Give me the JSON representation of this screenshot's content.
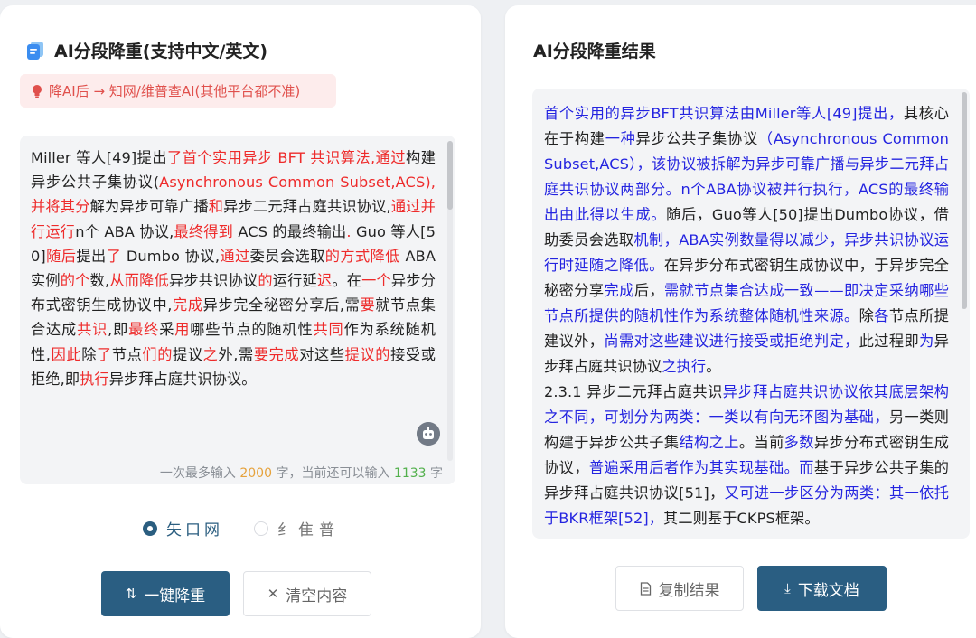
{
  "left": {
    "title": "AI分段降重(支持中文/英文)",
    "tip": "降AI后 → 知网/维普查AI(其他平台都不准)",
    "input_segments": [
      {
        "t": "Miller 等人[49]提出",
        "c": "n"
      },
      {
        "t": "了首个实用异步 BFT 共识算法,通过",
        "c": "r"
      },
      {
        "t": "构建异步公共子集协议(",
        "c": "n"
      },
      {
        "t": "Asynchronous Common Subset,ACS),并将其分",
        "c": "r"
      },
      {
        "t": "解为异步可靠广播",
        "c": "n"
      },
      {
        "t": "和",
        "c": "r"
      },
      {
        "t": "异步二元拜占庭共识协议,",
        "c": "n"
      },
      {
        "t": "通过并行运行",
        "c": "r"
      },
      {
        "t": "n个 ABA 协议,",
        "c": "n"
      },
      {
        "t": "最终得到",
        "c": "r"
      },
      {
        "t": " ACS 的最终输出",
        "c": "n"
      },
      {
        "t": ".",
        "c": "r"
      },
      {
        "t": " Guo 等人[50]",
        "c": "n"
      },
      {
        "t": "随后",
        "c": "r"
      },
      {
        "t": "提出",
        "c": "n"
      },
      {
        "t": "了",
        "c": "r"
      },
      {
        "t": " Dumbo 协议,",
        "c": "n"
      },
      {
        "t": "通过",
        "c": "r"
      },
      {
        "t": "委员会选取",
        "c": "n"
      },
      {
        "t": "的方式降低",
        "c": "r"
      },
      {
        "t": " ABA 实例",
        "c": "n"
      },
      {
        "t": "的个",
        "c": "r"
      },
      {
        "t": "数,",
        "c": "n"
      },
      {
        "t": "从而降低",
        "c": "r"
      },
      {
        "t": "异步共识协议",
        "c": "n"
      },
      {
        "t": "的",
        "c": "r"
      },
      {
        "t": "运行延",
        "c": "n"
      },
      {
        "t": "迟",
        "c": "r"
      },
      {
        "t": "。在",
        "c": "n"
      },
      {
        "t": "一个",
        "c": "r"
      },
      {
        "t": "异步分布式密钥生成协议中,",
        "c": "n"
      },
      {
        "t": "完成",
        "c": "r"
      },
      {
        "t": "异步完全秘密分享后,需",
        "c": "n"
      },
      {
        "t": "要",
        "c": "r"
      },
      {
        "t": "就节点集合达成",
        "c": "n"
      },
      {
        "t": "共识",
        "c": "r"
      },
      {
        "t": ",即",
        "c": "n"
      },
      {
        "t": "最终",
        "c": "r"
      },
      {
        "t": "采",
        "c": "n"
      },
      {
        "t": "用",
        "c": "r"
      },
      {
        "t": "哪些节点的随机性",
        "c": "n"
      },
      {
        "t": "共同",
        "c": "r"
      },
      {
        "t": "作为系统随机性,",
        "c": "n"
      },
      {
        "t": "因此",
        "c": "r"
      },
      {
        "t": "除",
        "c": "n"
      },
      {
        "t": "了",
        "c": "r"
      },
      {
        "t": "节点",
        "c": "n"
      },
      {
        "t": "们的",
        "c": "r"
      },
      {
        "t": "提议",
        "c": "n"
      },
      {
        "t": "之",
        "c": "r"
      },
      {
        "t": "外,需",
        "c": "n"
      },
      {
        "t": "要完成",
        "c": "r"
      },
      {
        "t": "对这些",
        "c": "n"
      },
      {
        "t": "提议的",
        "c": "r"
      },
      {
        "t": "接受或拒绝,即",
        "c": "n"
      },
      {
        "t": "执行",
        "c": "r"
      },
      {
        "t": "异步拜占庭共识协议。",
        "c": "n"
      }
    ],
    "counter": {
      "prefix": "一次最多输入 ",
      "max": "2000",
      "mid": " 字，当前还可以输入 ",
      "remaining": "1133",
      "suffix": " 字"
    },
    "radio_options": [
      {
        "label": "矢口网",
        "selected": true
      },
      {
        "label": "纟隹普",
        "selected": false
      }
    ],
    "dedupe_button": "一键降重",
    "clear_button": "清空内容"
  },
  "right": {
    "title": "AI分段降重结果",
    "result_segments": [
      {
        "t": "首个实用的异步BFT共识算法由Miller等人[49]提出，",
        "c": "b"
      },
      {
        "t": "其核心在于构建",
        "c": "n"
      },
      {
        "t": "一种",
        "c": "b"
      },
      {
        "t": "异步公共子集协议",
        "c": "n"
      },
      {
        "t": "（Asynchronous Common Subset,ACS），该协议被拆解为异步可靠广播与异步二元拜占庭共识协议两部分。n个ABA协议被并行执行，ACS的最终输出由此得以生成。",
        "c": "b"
      },
      {
        "t": "随后，Guo等人[50]提出Dumbo协议，借助委员会选取",
        "c": "n"
      },
      {
        "t": "机制，ABA实例数量得以减少，异步共识协议运行时延随之降低。",
        "c": "b"
      },
      {
        "t": "在异步分布式密钥生成协议中，于异步完全秘密分享",
        "c": "n"
      },
      {
        "t": "完成",
        "c": "b"
      },
      {
        "t": "后，",
        "c": "n"
      },
      {
        "t": "需就节点集合达成一致——即决定采纳哪些节点所提供的随机性作为系统整体随机性来源。",
        "c": "b"
      },
      {
        "t": "除",
        "c": "n"
      },
      {
        "t": "各",
        "c": "b"
      },
      {
        "t": "节点所提建议外，",
        "c": "n"
      },
      {
        "t": "尚需对这些建议进行接受或拒绝判定，",
        "c": "b"
      },
      {
        "t": "此过程即",
        "c": "n"
      },
      {
        "t": "为",
        "c": "b"
      },
      {
        "t": "异步拜占庭共识协议",
        "c": "n"
      },
      {
        "t": "之执行",
        "c": "b"
      },
      {
        "t": "。",
        "c": "n"
      },
      {
        "t": "\n",
        "c": "n"
      },
      {
        "t": "2.3.1 异步二元拜占庭共识",
        "c": "n"
      },
      {
        "t": "异步拜占庭共识协议依其底层架构之不同，可划分为两类：一类以有向无环图为基础，",
        "c": "b"
      },
      {
        "t": "另一类则构建于异步公共子集",
        "c": "n"
      },
      {
        "t": "结构之上",
        "c": "b"
      },
      {
        "t": "。当前",
        "c": "n"
      },
      {
        "t": "多数",
        "c": "b"
      },
      {
        "t": "异步分布式密钥生成协议，",
        "c": "n"
      },
      {
        "t": "普遍采用后者作为其实现基础。而",
        "c": "b"
      },
      {
        "t": "基于异步公共子集的异步拜占庭共识协议[51]，",
        "c": "n"
      },
      {
        "t": "又可进一步区分为两类：其一依托于BKR框架[52]，",
        "c": "b"
      },
      {
        "t": "其二则基于CKPS框架。",
        "c": "n"
      }
    ],
    "copy_button": "复制结果",
    "download_button": "下载文档"
  },
  "colors": {
    "primary": "#2a5e82",
    "edit_red": "#ee2b2b",
    "edit_blue": "#2424e0",
    "tip_bg": "#fdecec",
    "tip_text": "#e0504c",
    "max_orange": "#e6a23c",
    "remaining_green": "#52b04c"
  },
  "icons": [
    "document-icon",
    "lightbulb-icon",
    "robot-icon",
    "dedupe-icon",
    "close-icon",
    "copy-icon",
    "download-icon"
  ]
}
